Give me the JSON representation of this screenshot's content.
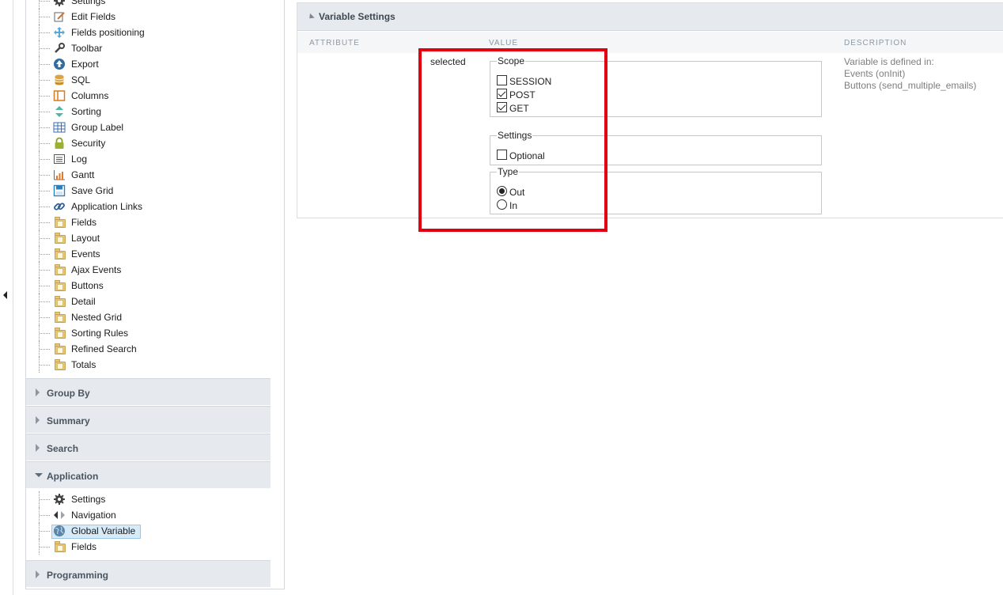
{
  "sidebar": {
    "tree_top_items": [
      {
        "label": "Settings",
        "icon": "gear-icon"
      },
      {
        "label": "Edit Fields",
        "icon": "edit-fields-icon"
      },
      {
        "label": "Fields positioning",
        "icon": "move-arrows-icon"
      },
      {
        "label": "Toolbar",
        "icon": "wrench-icon"
      },
      {
        "label": "Export",
        "icon": "export-arrow-icon"
      },
      {
        "label": "SQL",
        "icon": "database-icon"
      },
      {
        "label": "Columns",
        "icon": "columns-icon"
      },
      {
        "label": "Sorting",
        "icon": "sort-icon"
      },
      {
        "label": "Group Label",
        "icon": "table-icon"
      },
      {
        "label": "Security",
        "icon": "lock-icon"
      },
      {
        "label": "Log",
        "icon": "log-icon"
      },
      {
        "label": "Gantt",
        "icon": "gantt-chart-icon"
      },
      {
        "label": "Save Grid",
        "icon": "save-icon"
      },
      {
        "label": "Application Links",
        "icon": "link-icon"
      },
      {
        "label": "Fields",
        "icon": "folder-icon"
      },
      {
        "label": "Layout",
        "icon": "folder-icon"
      },
      {
        "label": "Events",
        "icon": "folder-icon"
      },
      {
        "label": "Ajax Events",
        "icon": "folder-icon"
      },
      {
        "label": "Buttons",
        "icon": "folder-icon"
      },
      {
        "label": "Detail",
        "icon": "folder-icon"
      },
      {
        "label": "Nested Grid",
        "icon": "folder-icon"
      },
      {
        "label": "Sorting Rules",
        "icon": "folder-icon"
      },
      {
        "label": "Refined Search",
        "icon": "folder-icon"
      },
      {
        "label": "Totals",
        "icon": "folder-icon"
      }
    ],
    "sections": {
      "group_by": "Group By",
      "summary": "Summary",
      "search": "Search",
      "application": "Application",
      "programming": "Programming"
    },
    "application_items": [
      {
        "label": "Settings",
        "icon": "gear-icon"
      },
      {
        "label": "Navigation",
        "icon": "navigation-icon"
      },
      {
        "label": "Global Variable",
        "icon": "globe-icon",
        "selected": true
      },
      {
        "label": "Fields",
        "icon": "folder-icon"
      }
    ]
  },
  "panel": {
    "title": "Variable Settings",
    "columns": {
      "attribute": "ATTRIBUTE",
      "value": "VALUE",
      "description": "DESCRIPTION"
    },
    "row": {
      "attribute": "selected",
      "scope": {
        "legend": "Scope",
        "options": [
          {
            "label": "SESSION",
            "checked": false
          },
          {
            "label": "POST",
            "checked": true
          },
          {
            "label": "GET",
            "checked": true
          }
        ]
      },
      "settings": {
        "legend": "Settings",
        "options": [
          {
            "label": "Optional",
            "checked": false
          }
        ]
      },
      "type": {
        "legend": "Type",
        "options": [
          {
            "label": "Out",
            "checked": true
          },
          {
            "label": "In",
            "checked": false
          }
        ]
      },
      "description": {
        "line1": "Variable is defined in:",
        "line2": "Events (onInit)",
        "line3": "Buttons (send_multiple_emails)"
      }
    }
  },
  "colors": {
    "highlight": "#e30010",
    "section_bg": "#e6eaee",
    "selected_bg": "#d7eaf8"
  }
}
